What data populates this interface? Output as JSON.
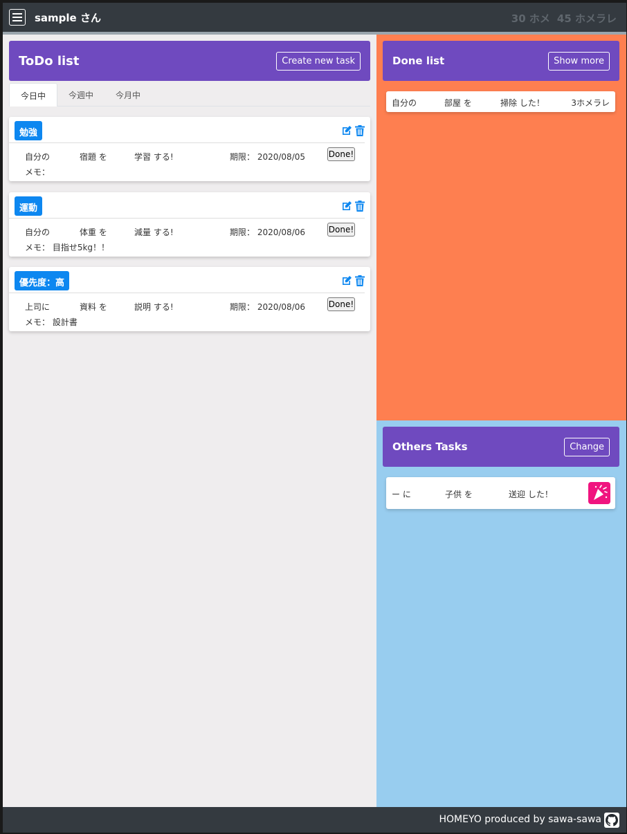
{
  "nav": {
    "user": "sample さん",
    "points_home": "30 ホメ",
    "points_homerare": "45 ホメラレ"
  },
  "todo": {
    "title": "ToDo list",
    "create_label": "Create new task",
    "tabs": [
      {
        "label": "今日中"
      },
      {
        "label": "今週中"
      },
      {
        "label": "今月中"
      }
    ],
    "tasks": [
      {
        "tag": "勉強",
        "who": "自分の",
        "object": "宿題 を",
        "action": "学習 する!",
        "due_label": "期限：",
        "due": "2020/08/05",
        "done_label": "Done!",
        "memo": "メモ："
      },
      {
        "tag": "運動",
        "who": "自分の",
        "object": "体重 を",
        "action": "減量 する!",
        "due_label": "期限：",
        "due": "2020/08/06",
        "done_label": "Done!",
        "memo": "メモ： 目指せ5kg！！"
      },
      {
        "tag": "優先度：高",
        "who": "上司に",
        "object": "資料 を",
        "action": "説明 する!",
        "due_label": "期限：",
        "due": "2020/08/06",
        "done_label": "Done!",
        "memo": "メモ： 設計書"
      }
    ]
  },
  "done": {
    "title": "Done list",
    "more_label": "Show more",
    "items": [
      {
        "who": "自分の",
        "object": "部屋 を",
        "action": "掃除 した！",
        "points": "3ホメラレ"
      }
    ]
  },
  "others": {
    "title": "Others Tasks",
    "change_label": "Change",
    "items": [
      {
        "who": "ー に",
        "object": "子供 を",
        "action": "送迎 した！",
        "icon": "party-popper-icon"
      }
    ]
  },
  "footer": {
    "text": "HOMEYO produced by sawa-sawa"
  },
  "colors": {
    "nav": "#343a40",
    "purple": "#6f4abf",
    "orange": "#fe7f50",
    "sky": "#98cdef",
    "blue": "#0d87f0"
  }
}
